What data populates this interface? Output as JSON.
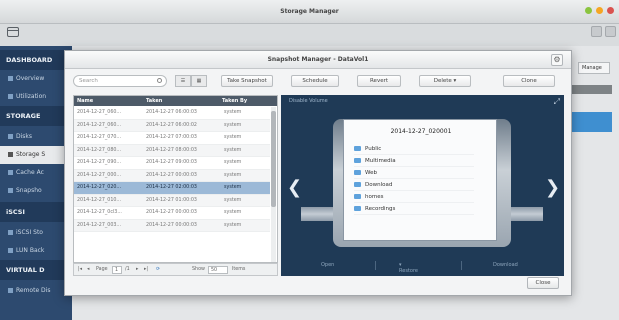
{
  "window": {
    "title": "Storage Manager"
  },
  "window_buttons_colors": [
    "#8ac43f",
    "#f5a623",
    "#d9534f"
  ],
  "sidebar": {
    "headers": [
      "DASHBOARD",
      "STORAGE",
      "iSCSI",
      "VIRTUAL D"
    ],
    "items": [
      {
        "label": "Overview"
      },
      {
        "label": "Utilization"
      },
      {
        "label": "Disks"
      },
      {
        "label": "Storage S"
      },
      {
        "label": "Cache Ac"
      },
      {
        "label": "Snapsho"
      },
      {
        "label": "iSCSI Sto"
      },
      {
        "label": "LUN Back"
      },
      {
        "label": "Remote Dis"
      }
    ]
  },
  "background": {
    "right_button": "Manage"
  },
  "modal": {
    "title": "Snapshot Manager - DataVol1",
    "search_placeholder": "Search",
    "view_buttons": [
      "☰",
      "▦"
    ],
    "toolbar": {
      "take_snapshot": "Take Snapshot",
      "schedule": "Schedule",
      "revert": "Revert",
      "delete": "Delete",
      "clone": "Clone"
    },
    "columns": [
      "Name",
      "Taken",
      "Taken By"
    ],
    "rows": [
      {
        "name": "2014-12-27_060...",
        "taken": "2014-12-27 06:00:03",
        "by": "system"
      },
      {
        "name": "2014-12-27_060...",
        "taken": "2014-12-27 06:00:02",
        "by": "system"
      },
      {
        "name": "2014-12-27_070...",
        "taken": "2014-12-27 07:00:03",
        "by": "system"
      },
      {
        "name": "2014-12-27_080...",
        "taken": "2014-12-27 08:00:03",
        "by": "system"
      },
      {
        "name": "2014-12-27_090...",
        "taken": "2014-12-27 09:00:03",
        "by": "system"
      },
      {
        "name": "2014-12-27_000...",
        "taken": "2014-12-27 00:00:03",
        "by": "system"
      },
      {
        "name": "2014-12-27_020...",
        "taken": "2014-12-27 02:00:03",
        "by": "system"
      },
      {
        "name": "2014-12-27_010...",
        "taken": "2014-12-27 01:00:03",
        "by": "system"
      },
      {
        "name": "2014-12-27_0cl3...",
        "taken": "2014-12-27 00:00:03",
        "by": "system"
      },
      {
        "name": "2014-12-27_003...",
        "taken": "2014-12-27 00:00:03",
        "by": "system"
      }
    ],
    "selected_row": 6,
    "pager": {
      "page_label": "Page",
      "page": "1",
      "of": "/1",
      "show_label": "Show",
      "per_page": "50",
      "items_label": "Items"
    },
    "preview": {
      "header": "Disable Volume",
      "snapshot_title": "2014-12-27_020001",
      "folders": [
        "Public",
        "Multimedia",
        "Web",
        "Download",
        "homes",
        "Recordings"
      ],
      "actions": [
        "Open",
        "Restore",
        "Download"
      ]
    },
    "close_label": "Close"
  }
}
